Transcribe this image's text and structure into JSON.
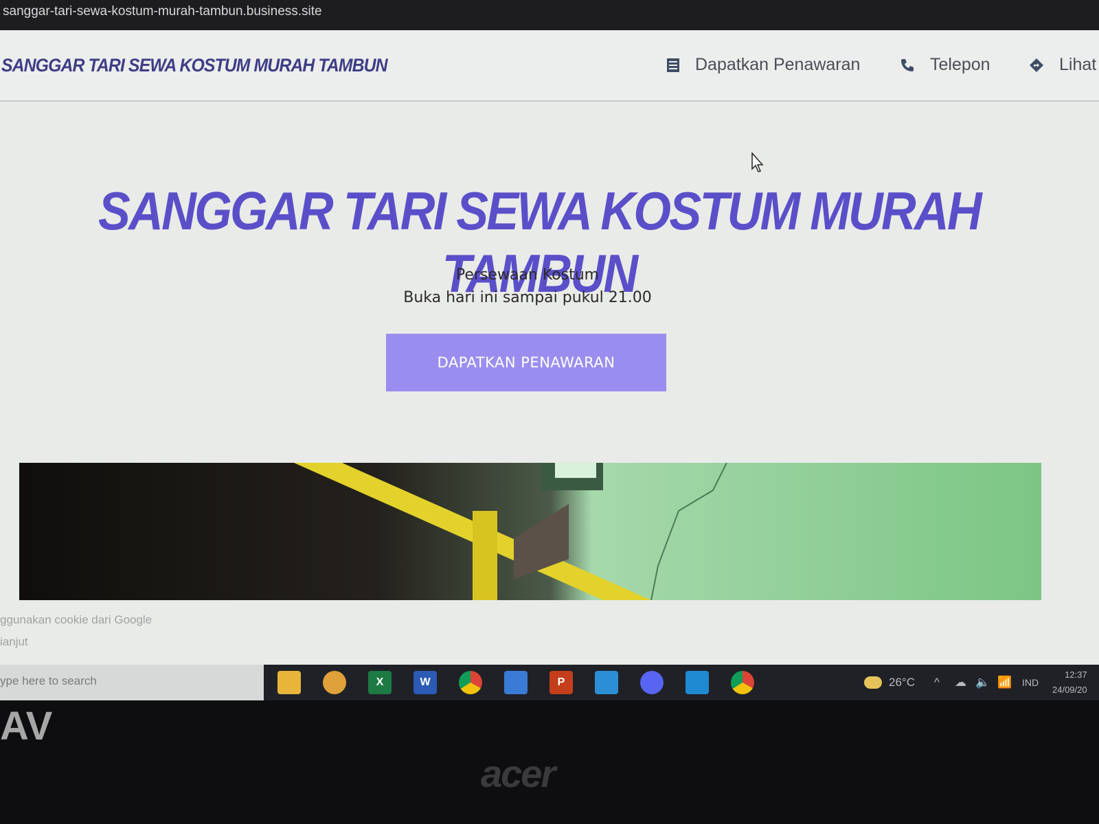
{
  "browser": {
    "url": "sanggar-tari-sewa-kostum-murah-tambun.business.site"
  },
  "header": {
    "brand": "SANGGAR TARI SEWA KOSTUM MURAH TAMBUN",
    "nav": [
      {
        "label": "Dapatkan Penawaran",
        "icon": "list-icon"
      },
      {
        "label": "Telepon",
        "icon": "phone-icon"
      },
      {
        "label": "Lihat",
        "icon": "directions-icon"
      }
    ]
  },
  "hero": {
    "title": "SANGGAR TARI SEWA KOSTUM MURAH TAMBUN",
    "category": "Persewaan Kostum",
    "hours": "Buka hari ini sampai pukul 21.00",
    "cta_label": "DAPATKAN PENAWARAN"
  },
  "cookie_notice": {
    "line1": "ggunakan cookie dari Google",
    "line2": "ianjut"
  },
  "taskbar": {
    "search_placeholder": "ype here to search",
    "apps": [
      "file-explorer-icon",
      "chrome-canary-icon",
      "excel-icon",
      "word-icon",
      "chrome-icon",
      "store-icon",
      "powerpoint-icon",
      "mail-icon",
      "discord-icon",
      "vscode-icon",
      "chrome-app-icon"
    ],
    "weather": "26°C",
    "language": "IND",
    "time": "12:37",
    "date": "24/09/20"
  },
  "monitor": {
    "bezel_text": "AV",
    "brand": "acer"
  },
  "colors": {
    "brand_purple": "#5b4fc9",
    "cta_purple": "#9a8df0"
  }
}
